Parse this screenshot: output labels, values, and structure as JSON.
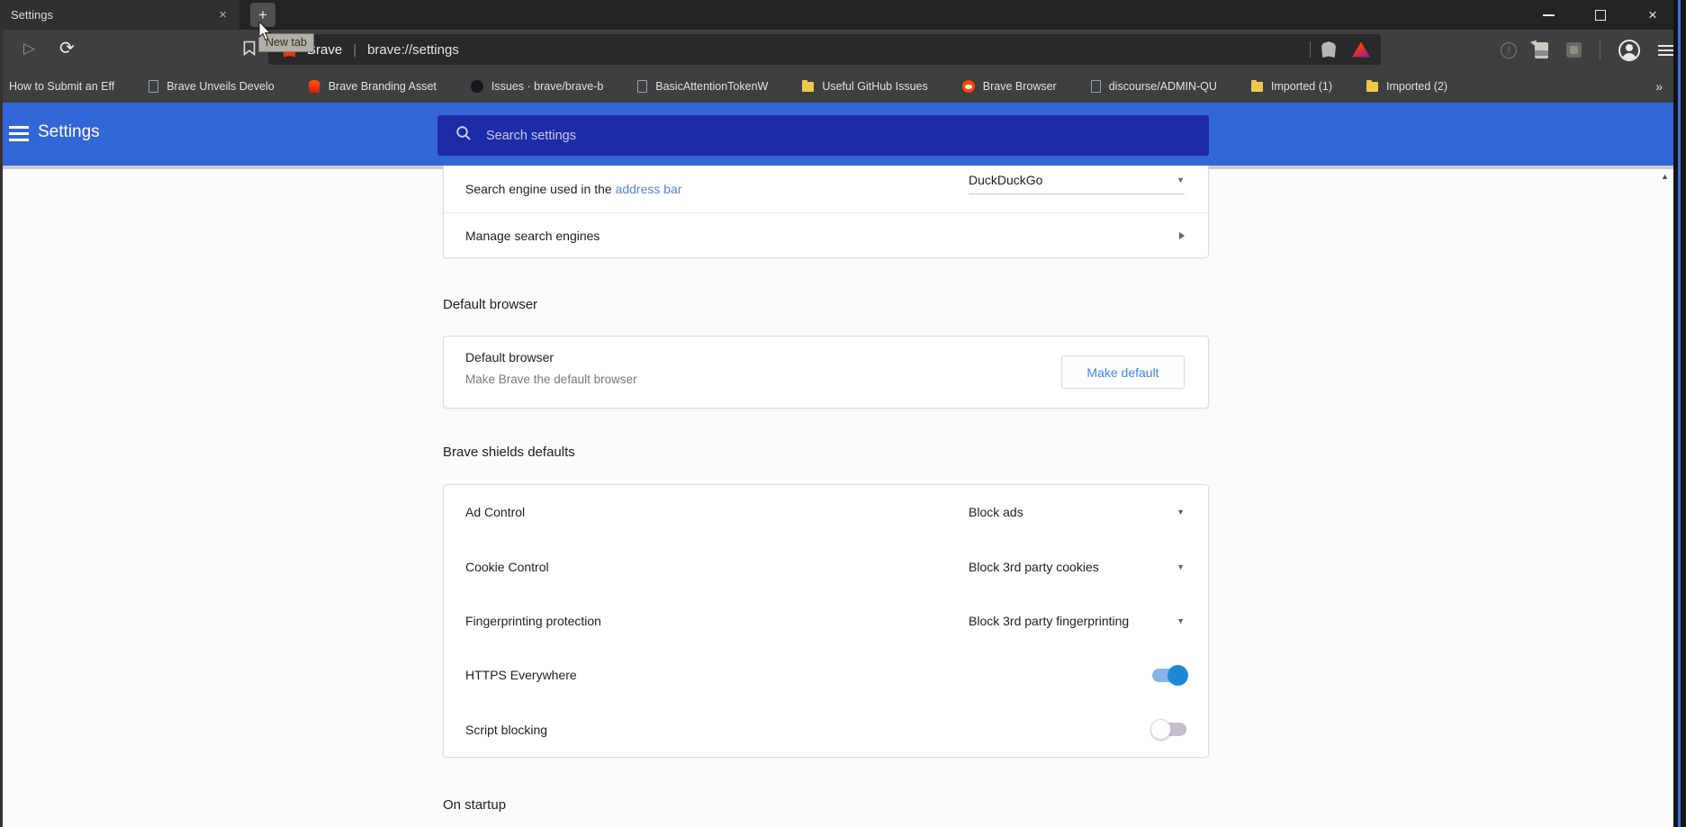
{
  "tab_bar": {
    "active_tab_title": "Settings",
    "tooltip": "New tab"
  },
  "window_controls": {
    "close": "×"
  },
  "glyphs": {
    "close": "×",
    "plus": "+",
    "forward": "▷",
    "reload": "⟳",
    "info": "!",
    "overflow": "»",
    "dropdown": "▼",
    "scroll_up": "▲"
  },
  "toolbar": {
    "site_badge": "Brave",
    "badge_separator": "|",
    "url": "brave://settings"
  },
  "bookmarks_bar": {
    "items": [
      {
        "label": "How to Submit an Eff"
      },
      {
        "label": "Brave Unveils Develo"
      },
      {
        "label": "Brave Branding Asset"
      },
      {
        "label": "Issues · brave/brave-b"
      },
      {
        "label": "BasicAttentionTokenW"
      },
      {
        "label": "Useful GitHub Issues"
      },
      {
        "label": "Brave Browser"
      },
      {
        "label": "discourse/ADMIN-QU"
      },
      {
        "label": "Imported (1)"
      },
      {
        "label": "Imported (2)"
      }
    ]
  },
  "settings_header": {
    "title": "Settings",
    "search_placeholder": "Search settings"
  },
  "content": {
    "search_card": {
      "engine_label_prefix": "Search engine used in the ",
      "engine_label_link": "address bar",
      "engine_value": "DuckDuckGo",
      "manage_label": "Manage search engines"
    },
    "default_browser": {
      "heading": "Default browser",
      "row_title": "Default browser",
      "row_subtitle": "Make Brave the default browser",
      "button_label": "Make default"
    },
    "shields": {
      "heading": "Brave shields defaults",
      "rows": [
        {
          "label": "Ad Control",
          "value": "Block ads"
        },
        {
          "label": "Cookie Control",
          "value": "Block 3rd party cookies"
        },
        {
          "label": "Fingerprinting protection",
          "value": "Block 3rd party fingerprinting"
        },
        {
          "label": "HTTPS Everywhere",
          "toggle": "on"
        },
        {
          "label": "Script blocking",
          "toggle": "off"
        }
      ]
    },
    "on_startup_heading": "On startup"
  },
  "colors": {
    "accent_blue": "#3366d6",
    "search_box_blue": "#1d2ba6",
    "link_blue": "#5a7fd8",
    "button_blue": "#4285f4",
    "toggle_on": "#1e88d6",
    "toggle_off_track": "#c4bcd0",
    "folder_yellow": "#f2c84b"
  }
}
